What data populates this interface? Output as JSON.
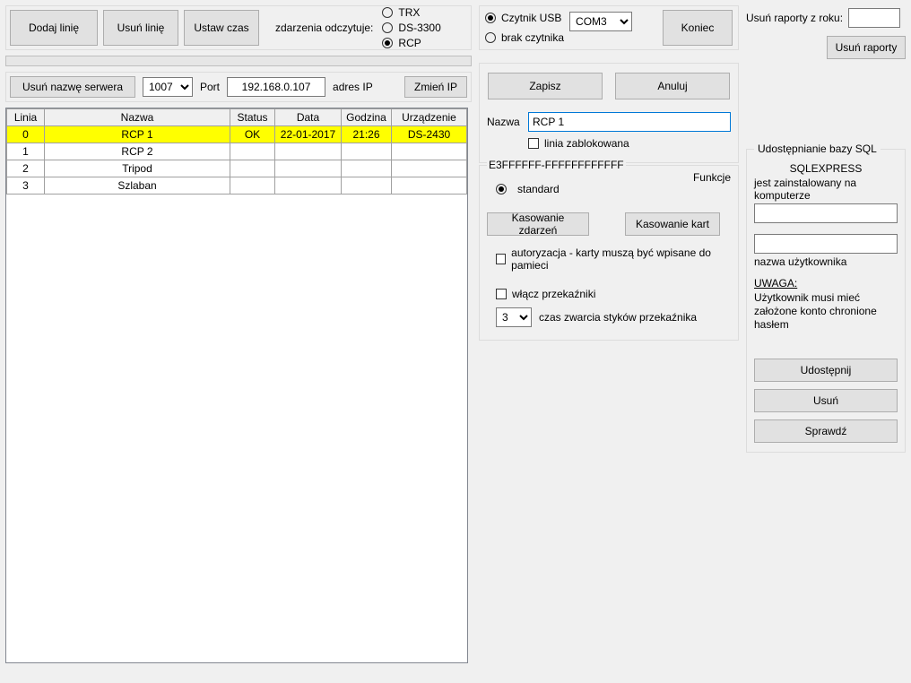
{
  "topButtons": {
    "addLine": "Dodaj linię",
    "deleteLine": "Usuń linię",
    "setTime": "Ustaw czas"
  },
  "eventsReadLabel": "zdarzenia odczytuje:",
  "eventsReadOptions": {
    "trx": "TRX",
    "ds3300": "DS-3300",
    "rcp": "RCP"
  },
  "readerGroup": {
    "usbLabel": "Czytnik USB",
    "usbPort": "COM3",
    "noReader": "brak czytnika",
    "close": "Koniec"
  },
  "reportsRow": {
    "label": "Usuń raporty z roku:",
    "value": "",
    "button": "Usuń raporty"
  },
  "serverRow": {
    "deleteServerName": "Usuń nazwę serwera",
    "portSelectValue": "1007",
    "portLabel": "Port",
    "ip": "192.168.0.107",
    "ipLabel": "adres IP",
    "changeIp": "Zmień IP"
  },
  "grid": {
    "headers": {
      "linia": "Linia",
      "nazwa": "Nazwa",
      "status": "Status",
      "data": "Data",
      "godzina": "Godzina",
      "urzadzenie": "Urządzenie"
    },
    "rows": [
      {
        "linia": "0",
        "nazwa": "RCP 1",
        "status": "OK",
        "data": "22-01-2017",
        "godzina": "21:26",
        "urzadzenie": "DS-2430",
        "selected": true
      },
      {
        "linia": "1",
        "nazwa": "RCP 2",
        "status": "",
        "data": "",
        "godzina": "",
        "urzadzenie": "",
        "selected": false
      },
      {
        "linia": "2",
        "nazwa": "Tripod",
        "status": "",
        "data": "",
        "godzina": "",
        "urzadzenie": "",
        "selected": false
      },
      {
        "linia": "3",
        "nazwa": "Szlaban",
        "status": "",
        "data": "",
        "godzina": "",
        "urzadzenie": "",
        "selected": false
      }
    ]
  },
  "editPanel": {
    "save": "Zapisz",
    "cancel": "Anuluj",
    "nameLabel": "Nazwa",
    "nameValue": "RCP 1",
    "lockedLabel": "linia zablokowana",
    "serial": "E3FFFFFF-FFFFFFFFFFFF",
    "functionsLabel": "Funkcje",
    "standard": "standard",
    "deleteEvents": "Kasowanie zdarzeń",
    "deleteCards": "Kasowanie kart",
    "authLabel": "autoryzacja - karty muszą być wpisane do pamieci",
    "relayLabel": "włącz przekaźniki",
    "relayTimeValue": "3",
    "relayTimeLabel": "czas zwarcia styków przekaźnika"
  },
  "sqlPanel": {
    "title": "Udostępnianie bazy SQL",
    "sqlExpress": "SQLEXPRESS",
    "installed": "jest zainstalowany na komputerze",
    "computerValue": "",
    "userValue": "",
    "userLabel": "nazwa użytkownika",
    "warning": "UWAGA:",
    "warningText": "Użytkownik musi mieć założone konto chronione hasłem",
    "share": "Udostępnij",
    "delete": "Usuń",
    "check": "Sprawdź"
  }
}
